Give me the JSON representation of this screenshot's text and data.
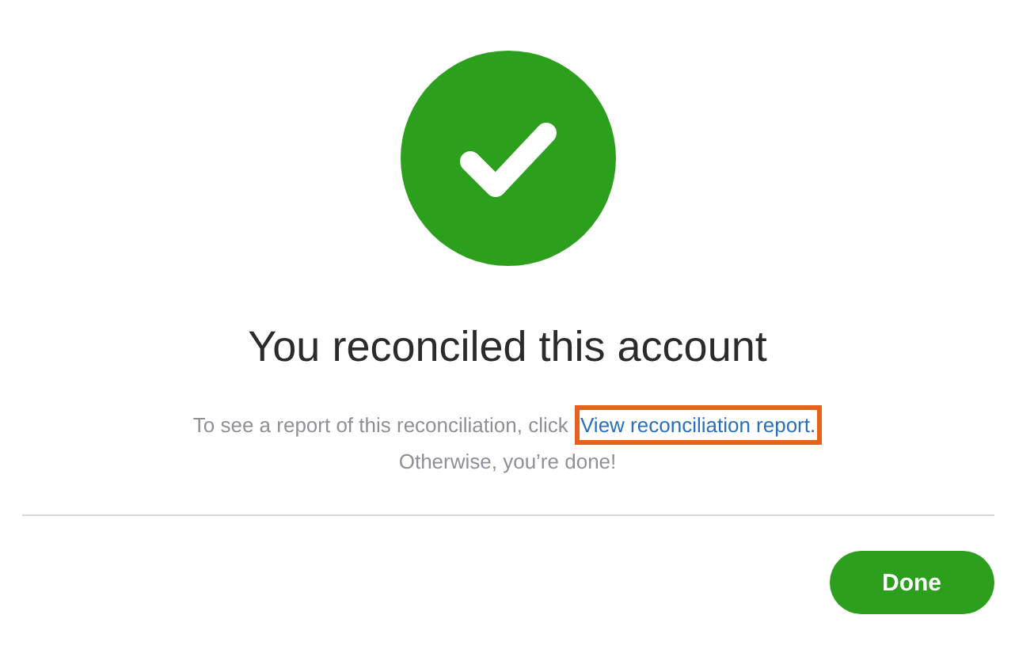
{
  "title": "You reconciled this account",
  "message": {
    "before_link": "To see a report of this reconciliation, click",
    "link": {
      "text": "View reconciliation report.",
      "highlighted": true
    },
    "after_link": "Otherwise, you’re done!"
  },
  "buttons": [
    {
      "label": "Done",
      "kind": "primary"
    }
  ]
}
